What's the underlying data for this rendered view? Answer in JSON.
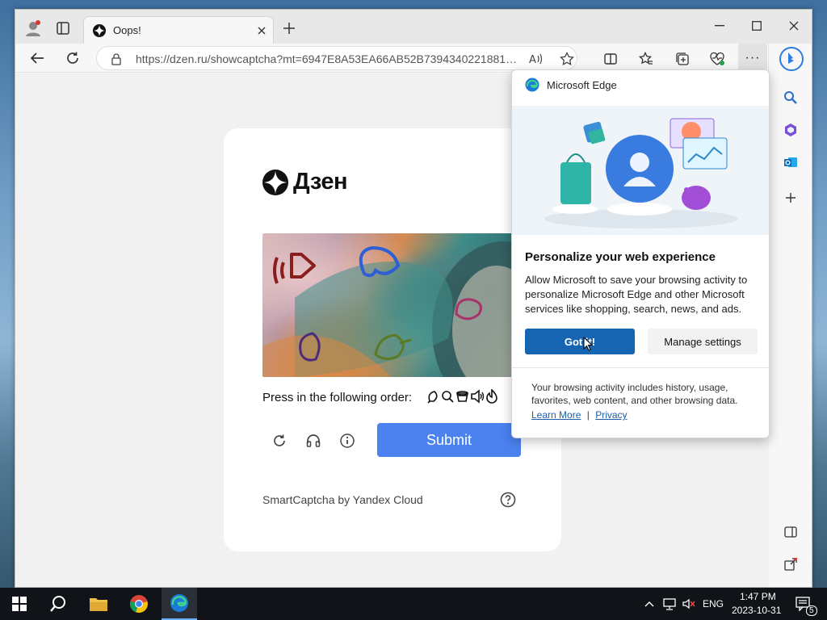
{
  "browser": {
    "tab_title": "Oops!",
    "url": "https://dzen.ru/showcaptcha?mt=6947E8A53EA66AB52B7394340221881EB..."
  },
  "page": {
    "logo_text": "Дзен",
    "instruction": "Press in the following order:",
    "submit_label": "Submit",
    "footer": "SmartCaptcha by Yandex Cloud"
  },
  "popup": {
    "app_name": "Microsoft Edge",
    "title": "Personalize your web experience",
    "body": "Allow Microsoft to save your browsing activity to personalize Microsoft Edge and other Microsoft services like shopping, search, news, and ads.",
    "primary_button": "Got it!",
    "secondary_button": "Manage settings",
    "note": "Your browsing activity includes history, usage, favorites, web content, and other browsing data.",
    "learn_more": "Learn More",
    "separator": "|",
    "privacy": "Privacy"
  },
  "taskbar": {
    "language": "ENG",
    "time": "1:47 PM",
    "date": "2023-10-31",
    "notification_count": "5"
  },
  "colors": {
    "submit_blue": "#4b82f0",
    "edge_primary": "#1665b3",
    "taskbar": "#101318"
  }
}
